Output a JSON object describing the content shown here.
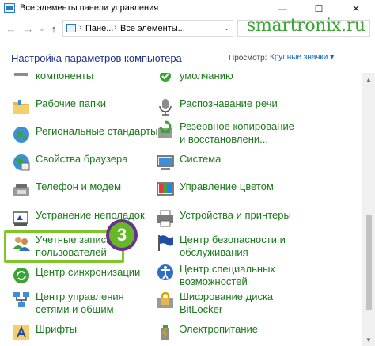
{
  "window": {
    "title": "Все элементы панели управления",
    "minimize": "—",
    "maximize": "☐",
    "close": "✕"
  },
  "nav": {
    "back": "←",
    "forward": "→",
    "recent": "⌄",
    "up": "↑"
  },
  "address": {
    "sep1": "›",
    "seg1": "Пане...",
    "sep2": "›",
    "seg2": "Все элементы...",
    "dropdown": "⌄"
  },
  "watermark": "smartronix.ru",
  "header": {
    "title": "Настройка параметров компьютера",
    "view_label": "Просмотр:",
    "view_value": "Крупные значки ▾"
  },
  "left_items": [
    {
      "label": "компоненты",
      "icon": "components-icon"
    },
    {
      "label": "Рабочие папки",
      "icon": "folder-icon"
    },
    {
      "label": "Региональные стандарты",
      "icon": "region-icon"
    },
    {
      "label": "Свойства браузера",
      "icon": "browser-icon"
    },
    {
      "label": "Телефон и модем",
      "icon": "phone-icon"
    },
    {
      "label": "Устранение неполадок",
      "icon": "troubleshoot-icon"
    },
    {
      "label1": "Учетные записи",
      "label2": "пользователей",
      "icon": "users-icon"
    },
    {
      "label": "Центр синхронизации",
      "icon": "sync-icon"
    },
    {
      "label1": "Центр управления",
      "label2": "сетями и общим",
      "icon": "network-icon"
    },
    {
      "label": "Шрифты",
      "icon": "fonts-icon"
    }
  ],
  "right_items": [
    {
      "label": "умолчанию",
      "icon": "default-programs-icon"
    },
    {
      "label": "Распознавание речи",
      "icon": "microphone-icon"
    },
    {
      "label1": "Резервное копирование",
      "label2": "и восстановлени...",
      "icon": "backup-icon"
    },
    {
      "label": "Система",
      "icon": "system-icon"
    },
    {
      "label": "Управление цветом",
      "icon": "color-icon"
    },
    {
      "label": "Устройства и принтеры",
      "icon": "printer-icon"
    },
    {
      "label1": "Центр безопасности и",
      "label2": "обслуживания",
      "icon": "flag-icon"
    },
    {
      "label1": "Центр специальных",
      "label2": "возможностей",
      "icon": "accessibility-icon"
    },
    {
      "label1": "Шифрование диска",
      "label2": "BitLocker",
      "icon": "bitlocker-icon"
    },
    {
      "label": "Электропитание",
      "icon": "power-icon"
    }
  ],
  "badge": "3",
  "scroll": {
    "up": "▲",
    "down": "▼"
  },
  "colors": {
    "link_green": "#1a7a1a",
    "heading_blue": "#1e3287",
    "highlight": "#7fc62a",
    "badge_ring": "#6a2f91",
    "badge_fill": "#66b82a",
    "watermark": "#3aa535"
  }
}
